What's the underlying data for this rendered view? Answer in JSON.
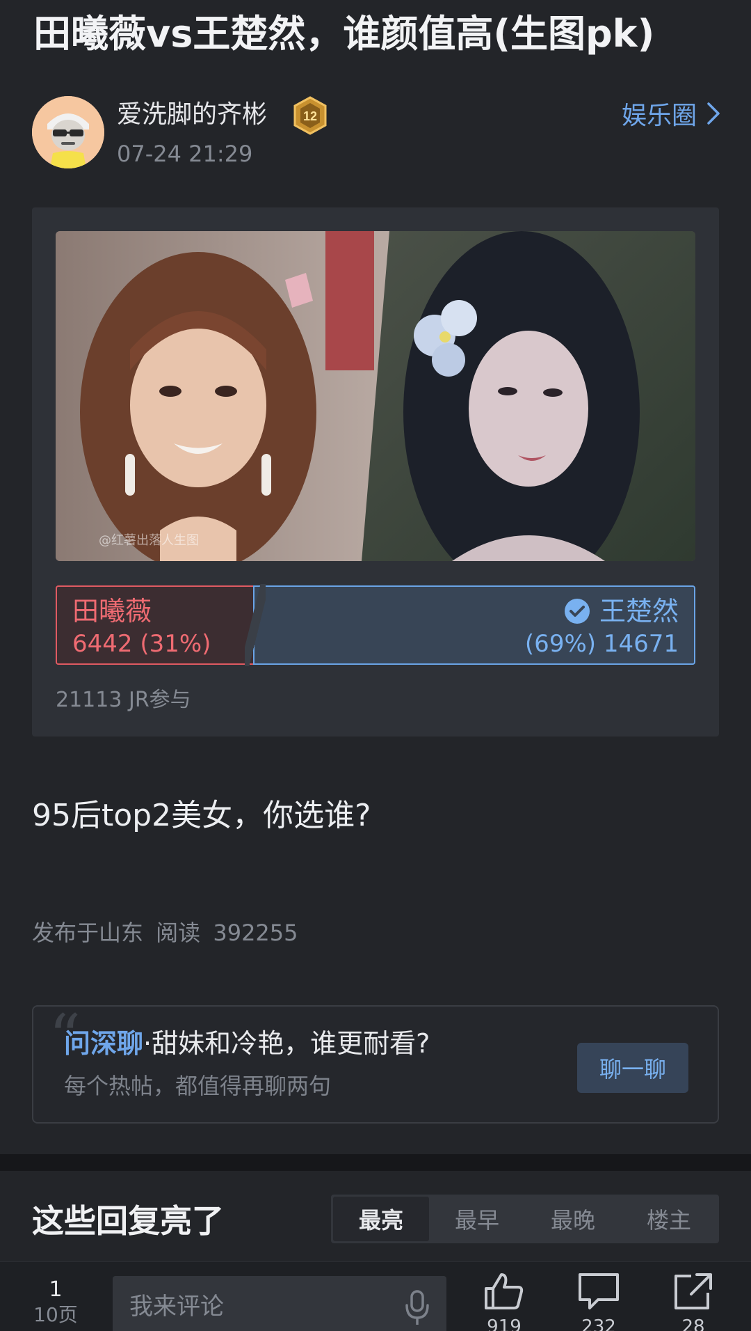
{
  "post": {
    "title": "田曦薇vs王楚然，谁颜值高(生图pk)",
    "body": "95后top2美女，你选谁?",
    "meta": "发布于山东  阅读 392255"
  },
  "author": {
    "name": "爱洗脚的齐彬",
    "level": "12",
    "time": "07-24 21:29"
  },
  "circle": {
    "label": "娱乐圈"
  },
  "poll": {
    "watermark": "@红薯出落人生图",
    "options": [
      {
        "name": "田曦薇",
        "stat": "6442 (31%)",
        "votes": 6442,
        "percent": 31,
        "color": "#ef6b72"
      },
      {
        "name": "王楚然",
        "stat": "(69%) 14671",
        "votes": 14671,
        "percent": 69,
        "color": "#79b1f0",
        "selected": true
      }
    ],
    "participants": "21113 JR参与"
  },
  "discussion": {
    "brand": "问深聊",
    "separator": "·",
    "topic": "甜妹和冷艳，谁更耐看?",
    "subtitle": "每个热帖，都值得再聊两句",
    "button": "聊一聊"
  },
  "replies": {
    "title": "这些回复亮了",
    "tabs": [
      "最亮",
      "最早",
      "最晚",
      "楼主"
    ],
    "active_tab": "最亮"
  },
  "bottom_bar": {
    "page_current": "1",
    "page_total": "10页",
    "comment_placeholder": "我来评论",
    "like_count": "919",
    "comment_count": "232",
    "share_count": "28"
  },
  "icons": {
    "badge": "level-badge-icon",
    "chevron": "chevron-right-icon",
    "check": "check-circle-icon",
    "mic": "microphone-icon",
    "like": "thumbs-up-icon",
    "comment": "comment-bubble-icon",
    "share": "share-icon"
  },
  "colors": {
    "background": "#232529",
    "accent_blue": "#6fa6ea",
    "accent_red": "#ef6b72"
  }
}
